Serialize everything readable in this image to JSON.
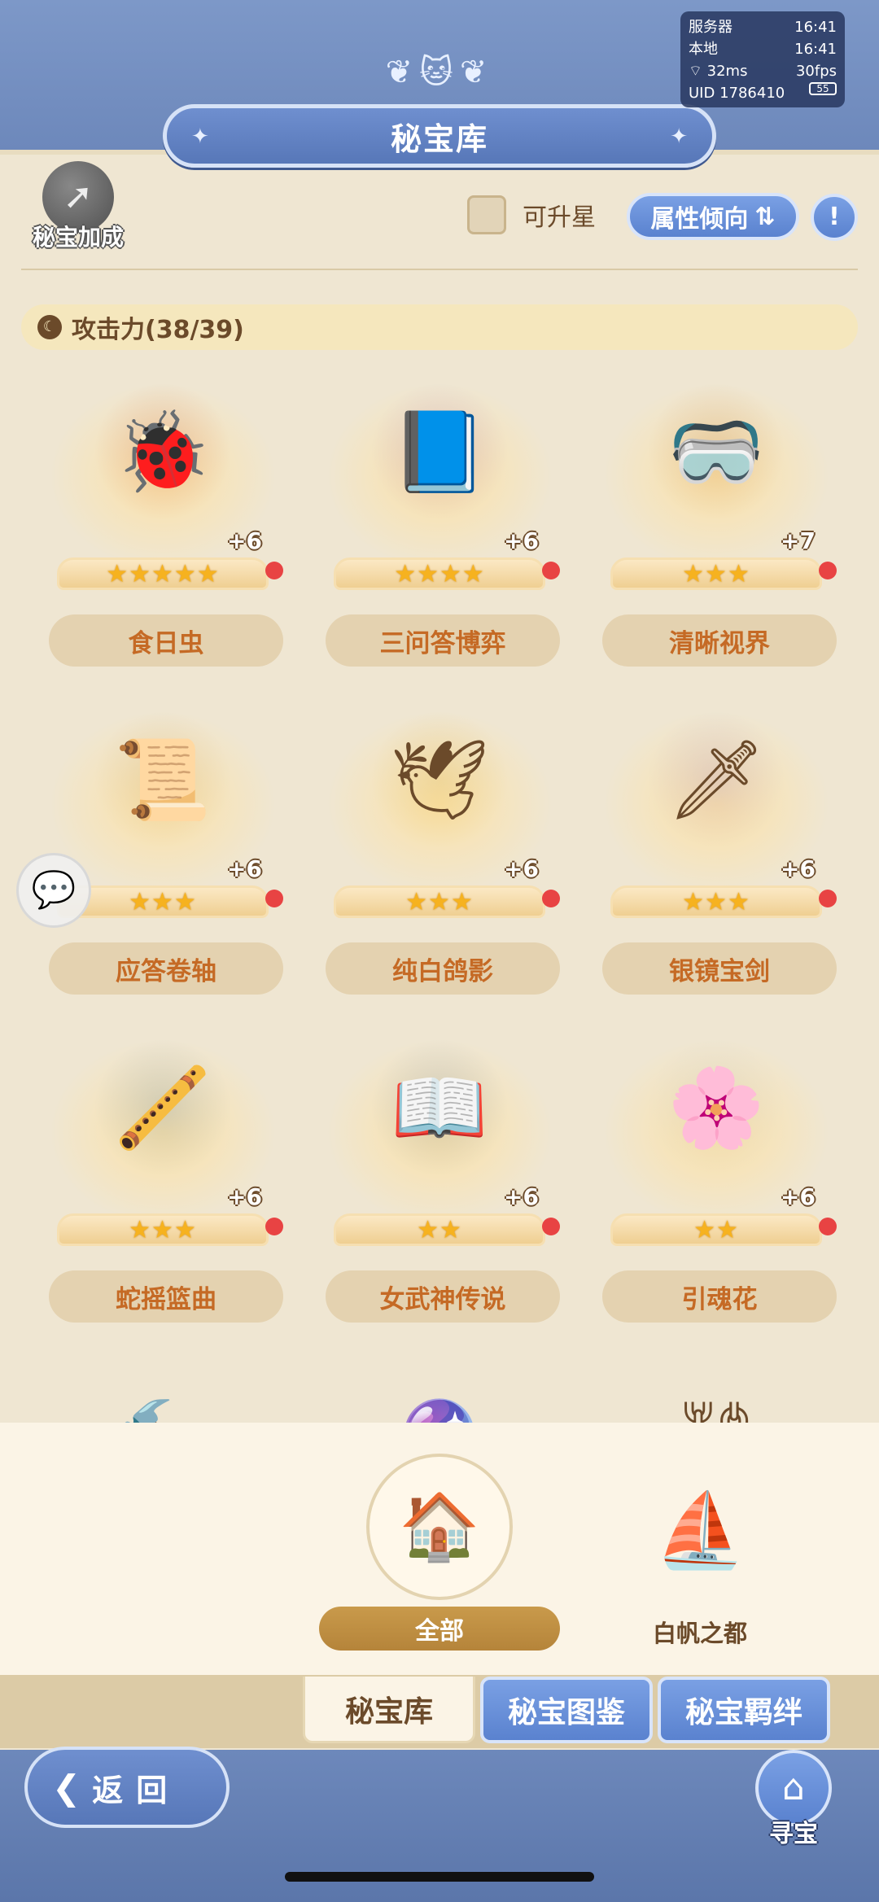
{
  "status": {
    "server_label": "服务器",
    "server_time": "16:41",
    "local_label": "本地",
    "local_time": "16:41",
    "ping": "32ms",
    "fps": "30fps",
    "uid": "UID 1786410",
    "battery": "55"
  },
  "header": {
    "title": "秘宝库"
  },
  "toolbar": {
    "bonus_label": "秘宝加成",
    "upgradable_label": "可升星",
    "attribute_label": "属性倾向",
    "info_icon": "!"
  },
  "section": {
    "title": "攻击力(38/39)"
  },
  "items": [
    {
      "name": "食日虫",
      "level": "+6",
      "stars": "★★★★★",
      "icon": "🐞",
      "color": "#b7341e"
    },
    {
      "name": "三问答博弈",
      "level": "+6",
      "stars": "★★★★",
      "icon": "📘",
      "color": "#7b3fc0"
    },
    {
      "name": "清晰视界",
      "level": "+7",
      "stars": "★★★",
      "icon": "🥽",
      "color": "#a6643a"
    },
    {
      "name": "应答卷轴",
      "level": "+6",
      "stars": "★★★",
      "icon": "📜",
      "color": "#b38e5a"
    },
    {
      "name": "纯白鸽影",
      "level": "+6",
      "stars": "★★★",
      "icon": "🕊",
      "color": "#c9a23a"
    },
    {
      "name": "银镜宝剑",
      "level": "+6",
      "stars": "★★★",
      "icon": "🗡",
      "color": "#8b70d0"
    },
    {
      "name": "蛇摇篮曲",
      "level": "+6",
      "stars": "★★★",
      "icon": "🪈",
      "color": "#3b6fb0"
    },
    {
      "name": "女武神传说",
      "level": "+6",
      "stars": "★★",
      "icon": "📖",
      "color": "#2f5fb5"
    },
    {
      "name": "引魂花",
      "level": "+6",
      "stars": "★★",
      "icon": "🌸",
      "color": "#9fb0d8"
    }
  ],
  "regions": {
    "all_label": "全部",
    "sail_label": "白帆之都"
  },
  "tabs": {
    "vault": "秘宝库",
    "compendium": "秘宝图鉴",
    "bonds": "秘宝羁绊"
  },
  "nav": {
    "back_label": "返回",
    "treasure_label": "寻宝"
  }
}
